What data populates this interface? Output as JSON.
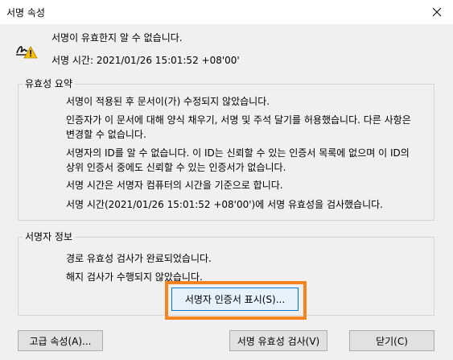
{
  "window": {
    "title": "서명 속성",
    "close_icon": "close-icon"
  },
  "header": {
    "icon": "signature-warning-icon",
    "status": "서명이 유효한지 알 수 없습니다.",
    "signing_time": "서명 시간: 2021/01/26 15:01:52 +08'00'"
  },
  "validity_summary": {
    "label": "유효성 요약",
    "paragraphs": [
      "서명이 적용된 후 문서이(가) 수정되지 않았습니다.",
      "인증자가 이 문서에 대해 양식 채우기, 서명 및 주석 달기를 허용했습니다. 다른 사항은 변경할 수 없습니다.",
      "서명자의 ID를 알 수 없습니다. 이 ID는 신뢰할 수 있는 인증서 목록에 없으며 이 ID의 상위 인증서 중에도 신뢰할 수 있는 인증서가 없습니다.",
      "서명 시간은 서명자 컴퓨터의 시간을 기준으로 합니다.",
      "서명 시간(2021/01/26 15:01:52 +08'00')에 서명 유효성을 검사했습니다."
    ]
  },
  "signer_info": {
    "label": "서명자 정보",
    "paragraphs": [
      "경로 유효성 검사가 완료되었습니다.",
      "해지 검사가 수행되지 않았습니다."
    ],
    "show_cert_button": "서명자 인증서 표시(S)..."
  },
  "buttons": {
    "advanced": "고급 속성(A)...",
    "validate": "서명 유효성 검사(V)",
    "close": "닫기(C)"
  },
  "highlight_color": "#f5841f"
}
